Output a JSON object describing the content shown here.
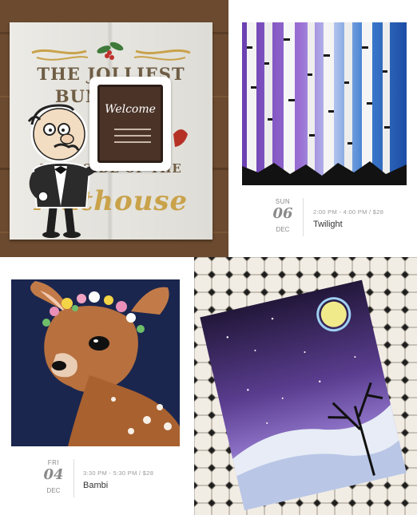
{
  "sign": {
    "lines": [
      "THE JOLLIEST",
      "BUNCH OF",
      "THIS SIDE OF THE",
      "Nuthouse"
    ],
    "badge_text": "Welcome",
    "colors": {
      "wood": "#e4e3de",
      "text": "#6f5d45",
      "gold": "#c9a24a",
      "board": "#4b3328"
    }
  },
  "events": [
    {
      "dow": "SUN",
      "day": "06",
      "month": "DEC",
      "meta": "2:00 PM - 4:00 PM / $28",
      "title": "Twilight"
    },
    {
      "dow": "FRI",
      "day": "04",
      "month": "DEC",
      "meta": "3:30 PM - 5:30 PM / $28",
      "title": "Bambi"
    }
  ]
}
